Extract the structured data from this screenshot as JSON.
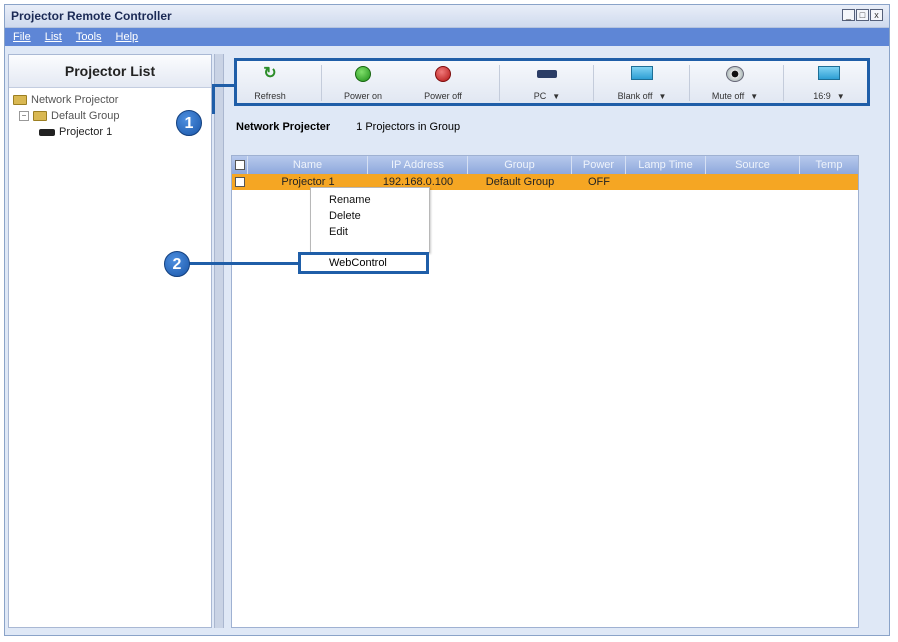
{
  "window": {
    "title": "Projector Remote Controller",
    "controls": [
      "_",
      "□",
      "x"
    ]
  },
  "menu": [
    "File",
    "List",
    "Tools",
    "Help"
  ],
  "left_panel": {
    "header": "Projector List",
    "tree": {
      "root": "Network Projector",
      "group": "Default Group",
      "projector": "Projector 1"
    }
  },
  "toolbar": {
    "refresh": "Refresh",
    "power_on": "Power on",
    "power_off": "Power off",
    "source": "PC",
    "blank": "Blank off",
    "mute": "Mute off",
    "aspect": "16:9"
  },
  "callouts": {
    "one": "1",
    "two": "2"
  },
  "info": {
    "title": "Network Projecter",
    "count": "1 Projectors in Group"
  },
  "grid": {
    "columns": [
      "Name",
      "IP Address",
      "Group",
      "Power",
      "Lamp Time",
      "Source",
      "Temp"
    ],
    "rows": [
      {
        "name": "Projector 1",
        "ip": "192.168.0.100",
        "group": "Default Group",
        "power": "OFF",
        "lamp": "",
        "source": "",
        "temp": ""
      }
    ]
  },
  "context_menu": {
    "items": [
      "Rename",
      "Delete",
      "Edit"
    ],
    "highlighted": "WebControl"
  },
  "colors": {
    "accent": "#1f5ea8",
    "menubar": "#5e86d6",
    "selected_row": "#f5a623"
  }
}
